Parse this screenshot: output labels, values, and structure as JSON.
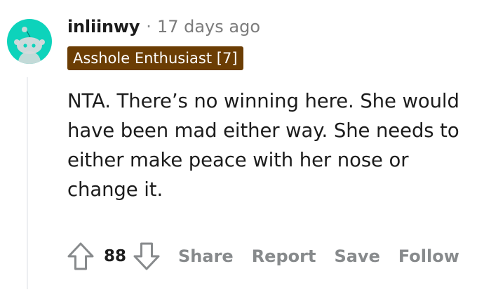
{
  "comment": {
    "username": "inliinwy",
    "separator": "·",
    "timestamp": "17 days ago",
    "flair": "Asshole Enthusiast [7]",
    "body": "NTA. There’s no winning here. She would have been mad either way. She needs to either make peace with her nose or change it.",
    "score": "88"
  },
  "actions": {
    "share": "Share",
    "report": "Report",
    "save": "Save",
    "follow": "Follow"
  },
  "icons": {
    "avatar": "reddit-snoo-avatar",
    "upvote": "upvote-arrow-icon",
    "downvote": "downvote-arrow-icon"
  },
  "colors": {
    "avatar_bg": "#0DD3BB",
    "flair_bg": "#6B3D04",
    "flair_text": "#FFFFFF",
    "muted_text": "#878A8C"
  }
}
